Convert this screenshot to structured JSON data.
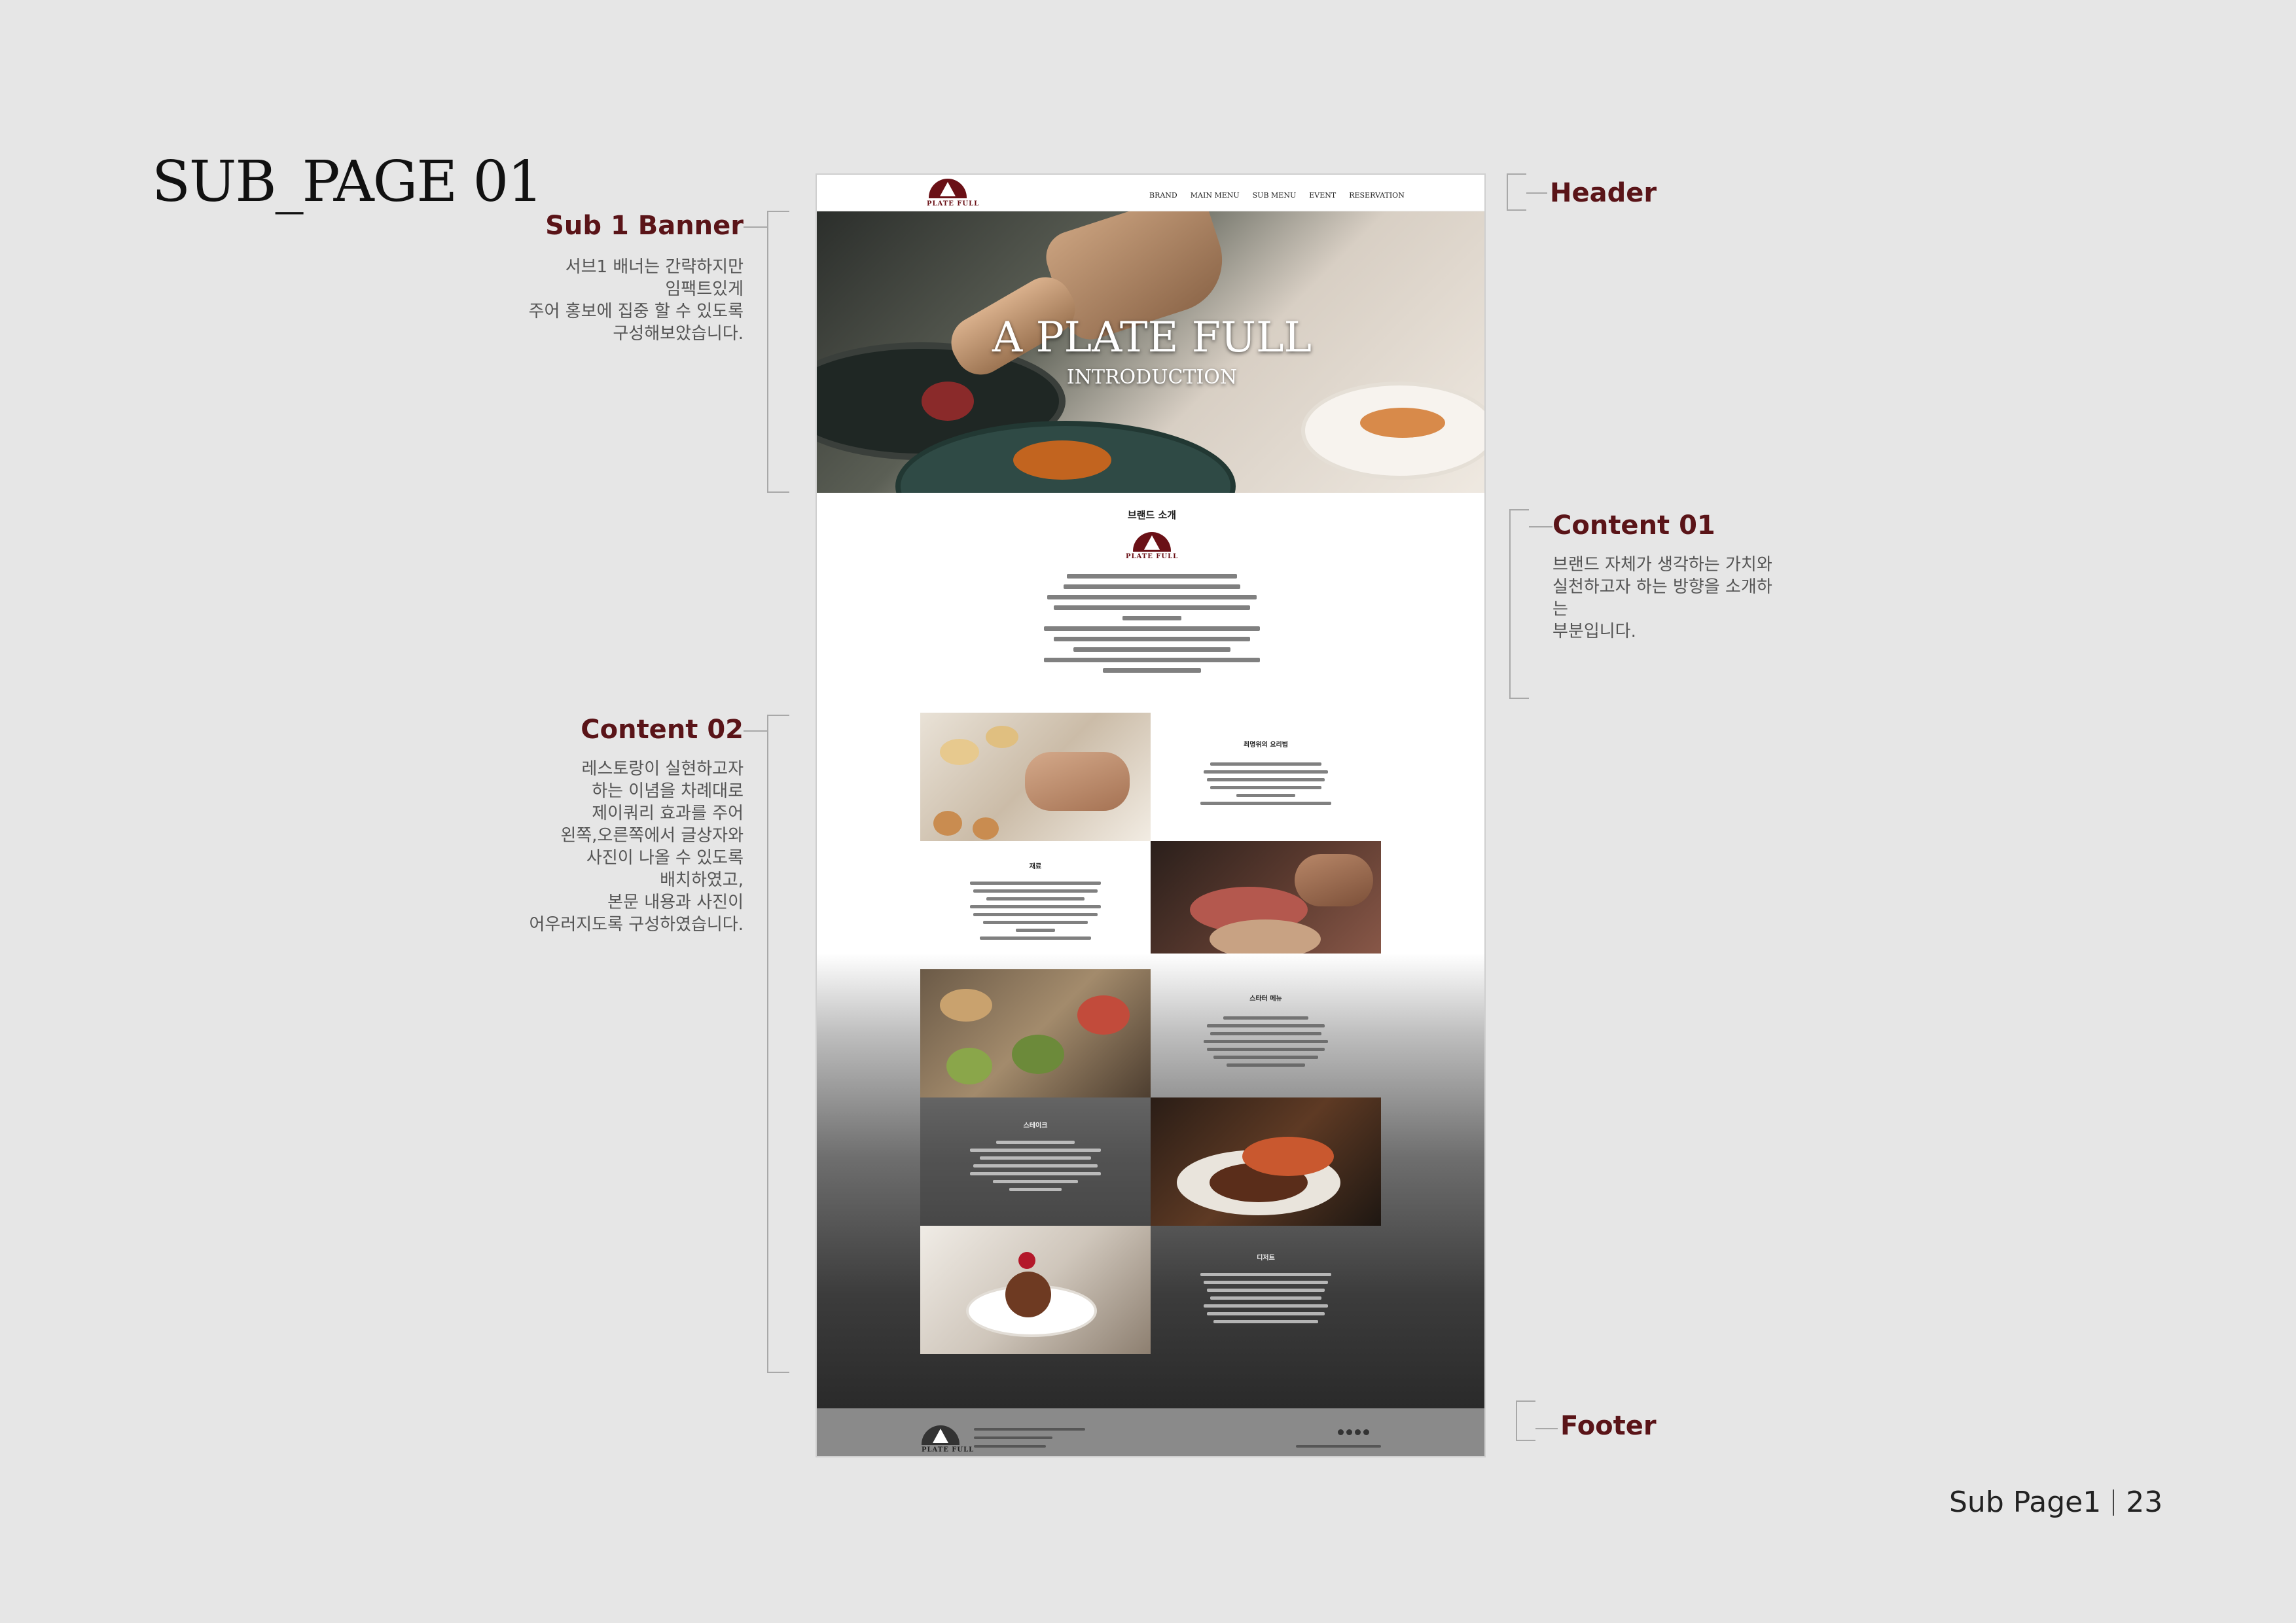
{
  "page": {
    "title": "SUB_PAGE 01"
  },
  "annotations": {
    "sub1_banner": {
      "title": "Sub 1 Banner",
      "desc": "서브1 배너는 간략하지만\n임팩트있게\n주어 홍보에 집중 할 수 있도록\n구성해보았습니다."
    },
    "content02": {
      "title": "Content 02",
      "desc": "레스토랑이 실현하고자\n하는 이념을 차례대로\n제이쿼리 효과를 주어\n왼쪽,오른쪽에서 글상자와\n사진이 나올 수 있도록\n배치하였고,\n본문 내용과 사진이\n어우러지도록 구성하였습니다."
    },
    "header": {
      "title": "Header"
    },
    "content01": {
      "title": "Content 01",
      "desc": "브랜드 자체가 생각하는 가치와\n실천하고자 하는 방향을 소개하\n는\n부분입니다."
    },
    "footer": {
      "title": "Footer"
    }
  },
  "mockup": {
    "logo_text": "PLATE FULL",
    "nav": [
      "BRAND",
      "MAIN MENU",
      "SUB MENU",
      "EVENT",
      "RESERVATION"
    ],
    "banner_title": "A PLATE FULL",
    "banner_subtitle": "INTRODUCTION",
    "brand_section_title": "브랜드 소개",
    "cards": [
      {
        "title": "최명위의 요리법"
      },
      {
        "title": "재료"
      },
      {
        "title": "스타터 메뉴"
      },
      {
        "title": "스테이크"
      },
      {
        "title": "디저트"
      }
    ]
  },
  "page_number": {
    "label": "Sub Page1",
    "number": "23"
  },
  "colors": {
    "accent": "#5a1418",
    "background": "#e6e6e6"
  }
}
